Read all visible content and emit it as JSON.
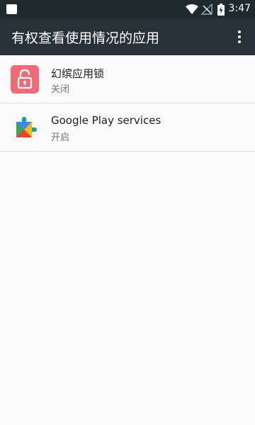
{
  "status_bar": {
    "time": "3:47",
    "icons": [
      "notification-icon",
      "wifi-icon",
      "no-sim-icon",
      "battery-charging-icon"
    ]
  },
  "app_bar": {
    "title": "有权查看使用情况的应用",
    "menu_icon": "more-vert-icon",
    "background": "#263238"
  },
  "apps": [
    {
      "name": "幻缤应用锁",
      "status": "关闭",
      "icon": "lock-app-icon",
      "icon_color": "#f06b75"
    },
    {
      "name": "Google Play services",
      "status": "开启",
      "icon": "google-play-services-icon"
    }
  ]
}
